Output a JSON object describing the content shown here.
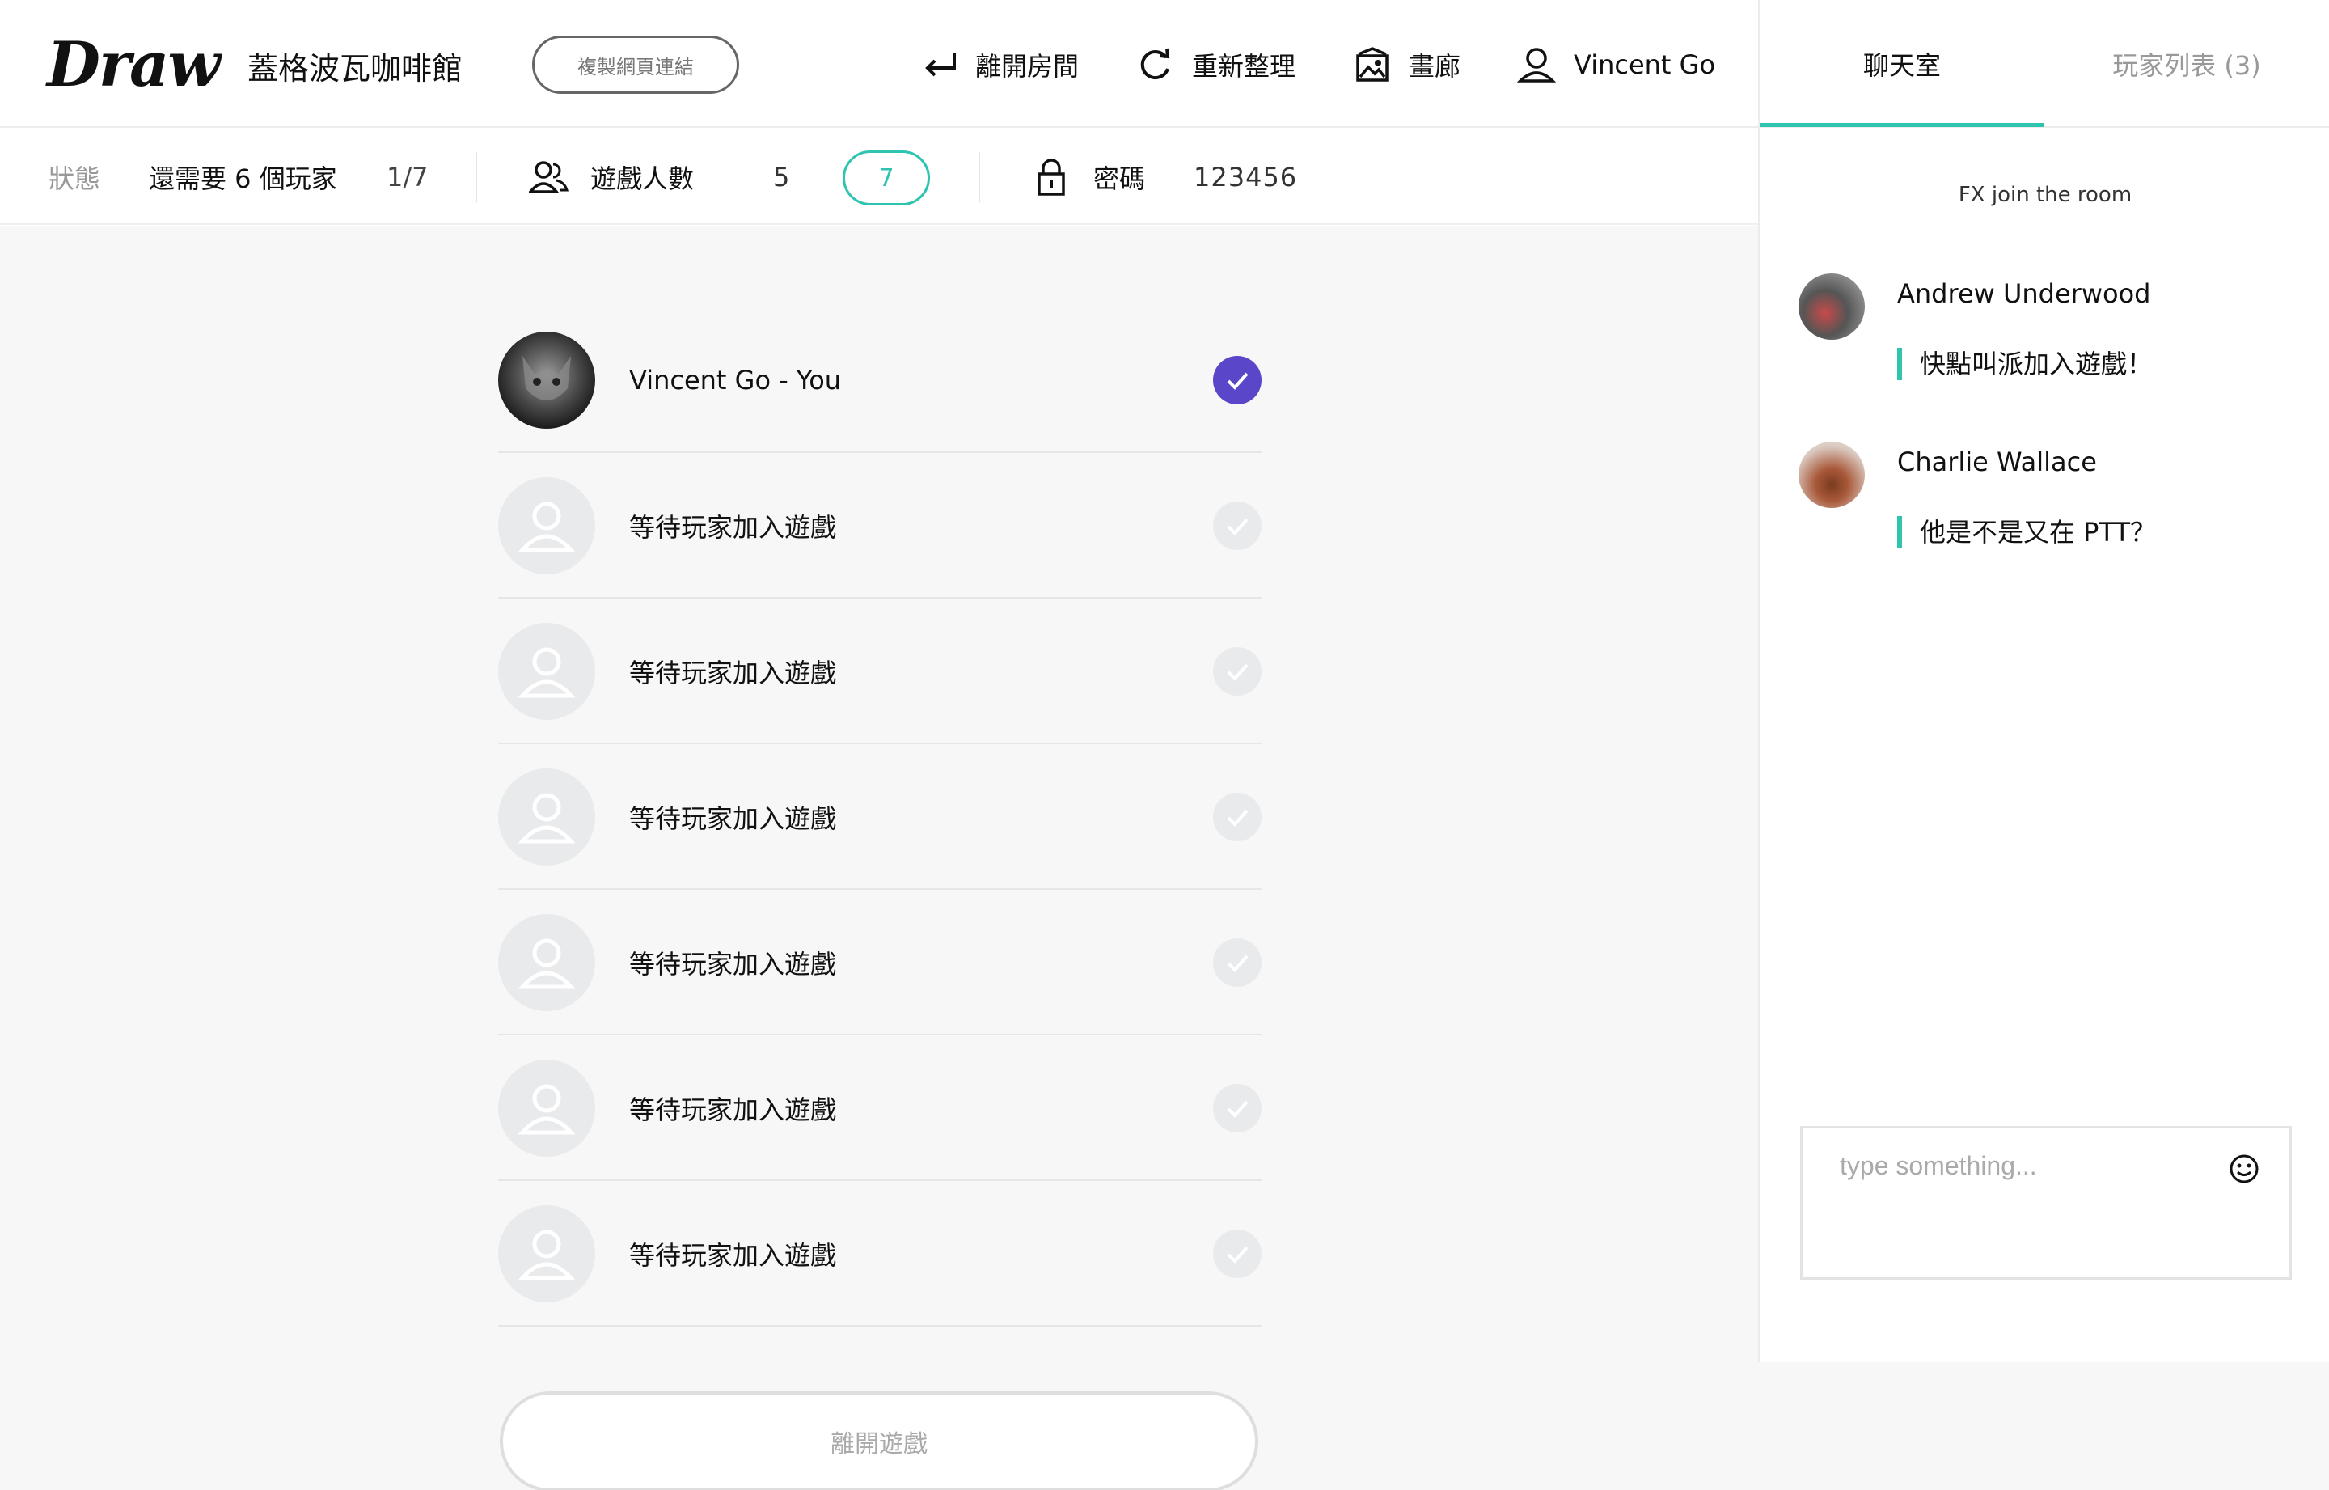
{
  "header": {
    "logo": "Draw",
    "room_name": "蓋格波瓦咖啡館",
    "copy_link_label": "複製網頁連結",
    "nav": {
      "leave_room": "離開房間",
      "refresh": "重新整理",
      "gallery": "畫廊",
      "user": "Vincent Go"
    }
  },
  "status": {
    "label": "狀態",
    "text": "還需要 6 個玩家",
    "count": "1/7",
    "players_label": "遊戲人數",
    "players_value": "5",
    "player_limit": "7",
    "password_label": "密碼",
    "password_value": "123456"
  },
  "players": [
    {
      "name": "Vincent Go - You",
      "ready": true
    },
    {
      "name": "等待玩家加入遊戲",
      "ready": false
    },
    {
      "name": "等待玩家加入遊戲",
      "ready": false
    },
    {
      "name": "等待玩家加入遊戲",
      "ready": false
    },
    {
      "name": "等待玩家加入遊戲",
      "ready": false
    },
    {
      "name": "等待玩家加入遊戲",
      "ready": false
    },
    {
      "name": "等待玩家加入遊戲",
      "ready": false
    }
  ],
  "leave_game_label": "離開遊戲",
  "chat": {
    "tabs": {
      "chat": "聊天室",
      "players": "玩家列表 (3)"
    },
    "system_message": "FX join the room",
    "messages": [
      {
        "author": "Andrew Underwood",
        "text": "快點叫派加入遊戲！"
      },
      {
        "author": "Charlie Wallace",
        "text": "他是不是又在 PTT？"
      }
    ],
    "input_placeholder": "type something..."
  },
  "colors": {
    "accent_teal": "#2ec4b0",
    "ready_purple": "#5946c8",
    "lobby_bg": "#f7f7f7"
  }
}
